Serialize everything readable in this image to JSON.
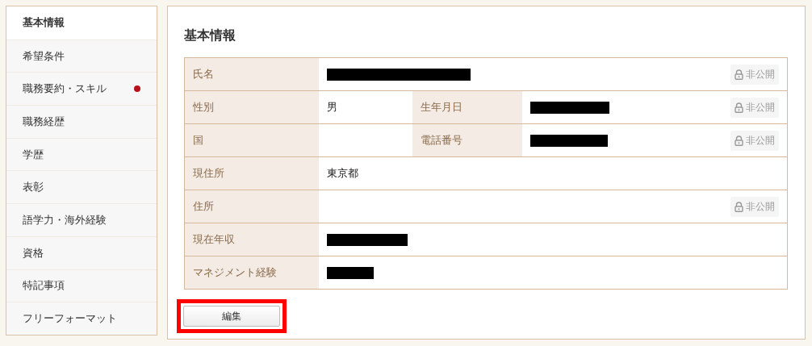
{
  "sidebar": {
    "items": [
      {
        "label": "基本情報",
        "selected": true,
        "alert": false
      },
      {
        "label": "希望条件",
        "selected": false,
        "alert": false
      },
      {
        "label": "職務要約・スキル",
        "selected": false,
        "alert": true
      },
      {
        "label": "職務経歴",
        "selected": false,
        "alert": false
      },
      {
        "label": "学歴",
        "selected": false,
        "alert": false
      },
      {
        "label": "表彰",
        "selected": false,
        "alert": false
      },
      {
        "label": "語学力・海外経験",
        "selected": false,
        "alert": false
      },
      {
        "label": "資格",
        "selected": false,
        "alert": false
      },
      {
        "label": "特記事項",
        "selected": false,
        "alert": false
      },
      {
        "label": "フリーフォーマット",
        "selected": false,
        "alert": false
      }
    ]
  },
  "main": {
    "title": "基本情報",
    "rows": [
      {
        "label": "氏名",
        "value": {
          "kind": "redacted"
        },
        "badge": "非公開"
      },
      {
        "label": "性別",
        "value": {
          "kind": "text",
          "text": "男"
        },
        "pair": {
          "label": "生年月日",
          "value": {
            "kind": "redacted"
          }
        },
        "badge": "非公開"
      },
      {
        "label": "国",
        "value": {
          "kind": "empty"
        },
        "pair": {
          "label": "電話番号",
          "value": {
            "kind": "redacted"
          }
        },
        "badge": "非公開"
      },
      {
        "label": "現住所",
        "value": {
          "kind": "text",
          "text": "東京都"
        }
      },
      {
        "label": "住所",
        "value": {
          "kind": "empty"
        },
        "badge": "非公開"
      },
      {
        "label": "現在年収",
        "value": {
          "kind": "redacted"
        }
      },
      {
        "label": "マネジメント経験",
        "value": {
          "kind": "redacted"
        }
      }
    ],
    "edit_button": {
      "label": "編集",
      "highlighted": true
    }
  }
}
